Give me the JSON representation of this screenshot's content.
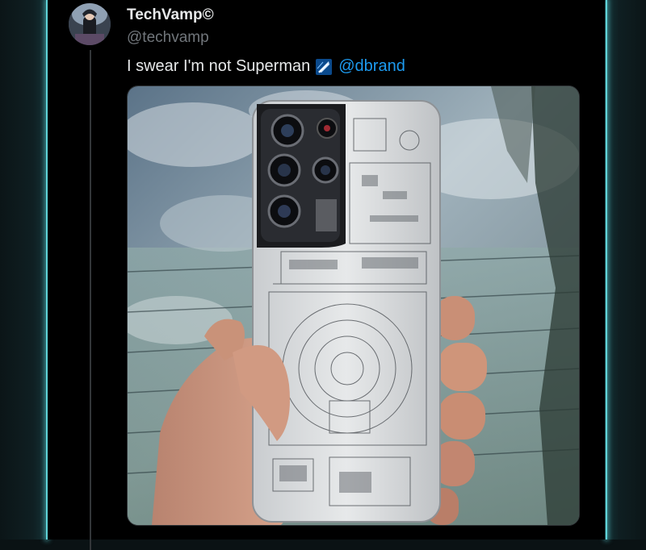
{
  "tweet": {
    "display_name": "TechVamp©",
    "handle": "@techvamp",
    "text_before_mention": "I swear I'm not Superman",
    "mention": "@dbrand",
    "media_alt": "hand holding phone with transparent skin"
  },
  "icons": {
    "avatar": "avatar",
    "flag": "dbrand-flag-icon"
  },
  "colors": {
    "background": "#000000",
    "accent_glow": "#5fd3d8",
    "mention": "#1d9bf0",
    "text": "#e7e9ea",
    "muted": "#71767b"
  }
}
